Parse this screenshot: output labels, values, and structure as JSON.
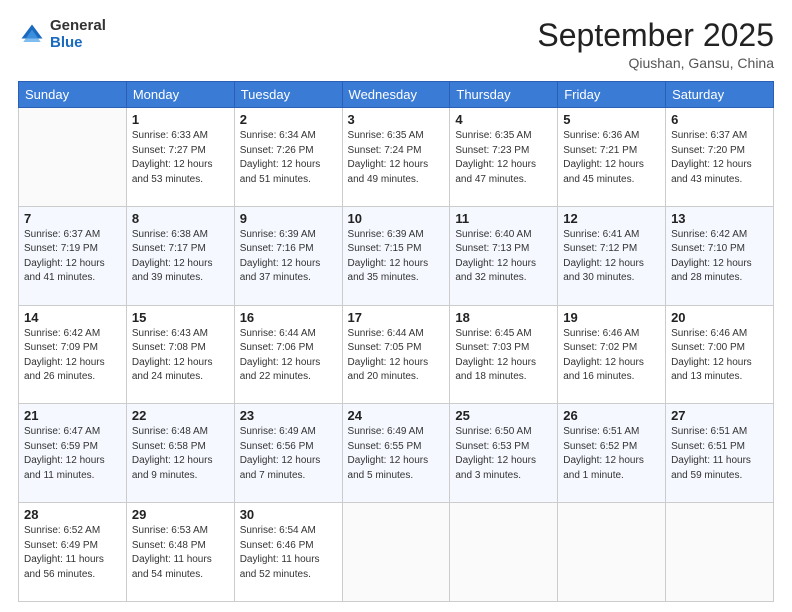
{
  "header": {
    "logo": {
      "general": "General",
      "blue": "Blue"
    },
    "title": "September 2025",
    "subtitle": "Qiushan, Gansu, China"
  },
  "weekdays": [
    "Sunday",
    "Monday",
    "Tuesday",
    "Wednesday",
    "Thursday",
    "Friday",
    "Saturday"
  ],
  "weeks": [
    [
      {
        "day": "",
        "info": ""
      },
      {
        "day": "1",
        "info": "Sunrise: 6:33 AM\nSunset: 7:27 PM\nDaylight: 12 hours\nand 53 minutes."
      },
      {
        "day": "2",
        "info": "Sunrise: 6:34 AM\nSunset: 7:26 PM\nDaylight: 12 hours\nand 51 minutes."
      },
      {
        "day": "3",
        "info": "Sunrise: 6:35 AM\nSunset: 7:24 PM\nDaylight: 12 hours\nand 49 minutes."
      },
      {
        "day": "4",
        "info": "Sunrise: 6:35 AM\nSunset: 7:23 PM\nDaylight: 12 hours\nand 47 minutes."
      },
      {
        "day": "5",
        "info": "Sunrise: 6:36 AM\nSunset: 7:21 PM\nDaylight: 12 hours\nand 45 minutes."
      },
      {
        "day": "6",
        "info": "Sunrise: 6:37 AM\nSunset: 7:20 PM\nDaylight: 12 hours\nand 43 minutes."
      }
    ],
    [
      {
        "day": "7",
        "info": "Sunrise: 6:37 AM\nSunset: 7:19 PM\nDaylight: 12 hours\nand 41 minutes."
      },
      {
        "day": "8",
        "info": "Sunrise: 6:38 AM\nSunset: 7:17 PM\nDaylight: 12 hours\nand 39 minutes."
      },
      {
        "day": "9",
        "info": "Sunrise: 6:39 AM\nSunset: 7:16 PM\nDaylight: 12 hours\nand 37 minutes."
      },
      {
        "day": "10",
        "info": "Sunrise: 6:39 AM\nSunset: 7:15 PM\nDaylight: 12 hours\nand 35 minutes."
      },
      {
        "day": "11",
        "info": "Sunrise: 6:40 AM\nSunset: 7:13 PM\nDaylight: 12 hours\nand 32 minutes."
      },
      {
        "day": "12",
        "info": "Sunrise: 6:41 AM\nSunset: 7:12 PM\nDaylight: 12 hours\nand 30 minutes."
      },
      {
        "day": "13",
        "info": "Sunrise: 6:42 AM\nSunset: 7:10 PM\nDaylight: 12 hours\nand 28 minutes."
      }
    ],
    [
      {
        "day": "14",
        "info": "Sunrise: 6:42 AM\nSunset: 7:09 PM\nDaylight: 12 hours\nand 26 minutes."
      },
      {
        "day": "15",
        "info": "Sunrise: 6:43 AM\nSunset: 7:08 PM\nDaylight: 12 hours\nand 24 minutes."
      },
      {
        "day": "16",
        "info": "Sunrise: 6:44 AM\nSunset: 7:06 PM\nDaylight: 12 hours\nand 22 minutes."
      },
      {
        "day": "17",
        "info": "Sunrise: 6:44 AM\nSunset: 7:05 PM\nDaylight: 12 hours\nand 20 minutes."
      },
      {
        "day": "18",
        "info": "Sunrise: 6:45 AM\nSunset: 7:03 PM\nDaylight: 12 hours\nand 18 minutes."
      },
      {
        "day": "19",
        "info": "Sunrise: 6:46 AM\nSunset: 7:02 PM\nDaylight: 12 hours\nand 16 minutes."
      },
      {
        "day": "20",
        "info": "Sunrise: 6:46 AM\nSunset: 7:00 PM\nDaylight: 12 hours\nand 13 minutes."
      }
    ],
    [
      {
        "day": "21",
        "info": "Sunrise: 6:47 AM\nSunset: 6:59 PM\nDaylight: 12 hours\nand 11 minutes."
      },
      {
        "day": "22",
        "info": "Sunrise: 6:48 AM\nSunset: 6:58 PM\nDaylight: 12 hours\nand 9 minutes."
      },
      {
        "day": "23",
        "info": "Sunrise: 6:49 AM\nSunset: 6:56 PM\nDaylight: 12 hours\nand 7 minutes."
      },
      {
        "day": "24",
        "info": "Sunrise: 6:49 AM\nSunset: 6:55 PM\nDaylight: 12 hours\nand 5 minutes."
      },
      {
        "day": "25",
        "info": "Sunrise: 6:50 AM\nSunset: 6:53 PM\nDaylight: 12 hours\nand 3 minutes."
      },
      {
        "day": "26",
        "info": "Sunrise: 6:51 AM\nSunset: 6:52 PM\nDaylight: 12 hours\nand 1 minute."
      },
      {
        "day": "27",
        "info": "Sunrise: 6:51 AM\nSunset: 6:51 PM\nDaylight: 11 hours\nand 59 minutes."
      }
    ],
    [
      {
        "day": "28",
        "info": "Sunrise: 6:52 AM\nSunset: 6:49 PM\nDaylight: 11 hours\nand 56 minutes."
      },
      {
        "day": "29",
        "info": "Sunrise: 6:53 AM\nSunset: 6:48 PM\nDaylight: 11 hours\nand 54 minutes."
      },
      {
        "day": "30",
        "info": "Sunrise: 6:54 AM\nSunset: 6:46 PM\nDaylight: 11 hours\nand 52 minutes."
      },
      {
        "day": "",
        "info": ""
      },
      {
        "day": "",
        "info": ""
      },
      {
        "day": "",
        "info": ""
      },
      {
        "day": "",
        "info": ""
      }
    ]
  ]
}
